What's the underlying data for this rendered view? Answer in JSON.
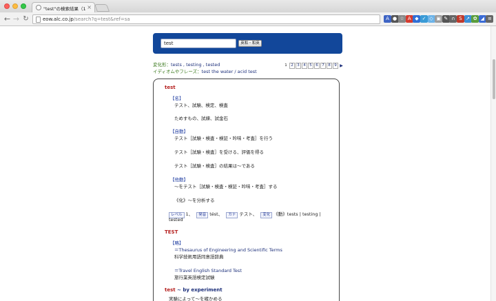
{
  "browser": {
    "tab_title": "\"test\"の検索結果（10184",
    "tab_close": "×",
    "url_host": "eow.alc.co.jp",
    "url_path": "/search?q=test&ref=sa",
    "nav_back": "←",
    "nav_forward": "→",
    "nav_reload": "↻",
    "extensions": [
      {
        "icon": "translate-icon",
        "glyph": "A",
        "color": "#3e64c4"
      },
      {
        "icon": "circle-extension-icon",
        "glyph": "●",
        "color": "#555555"
      },
      {
        "icon": "star-bookmark-icon",
        "glyph": "☆",
        "color": "#888888"
      },
      {
        "icon": "adobe-icon",
        "glyph": "A",
        "color": "#d63b2f"
      },
      {
        "icon": "shield-icon",
        "glyph": "◆",
        "color": "#2f6fd6"
      },
      {
        "icon": "bird-icon",
        "glyph": "✓",
        "color": "#3a9bd6"
      },
      {
        "icon": "cloud-icon",
        "glyph": "◇",
        "color": "#6cb3e8"
      },
      {
        "icon": "bookmark-box-icon",
        "glyph": "▣",
        "color": "#9c9c9c"
      },
      {
        "icon": "tool-icon",
        "glyph": "✎",
        "color": "#555555"
      },
      {
        "icon": "headphone-icon",
        "glyph": "∩",
        "color": "#666666"
      },
      {
        "icon": "s-badge-icon",
        "glyph": "S",
        "color": "#c0392b"
      },
      {
        "icon": "arrow-extension-icon",
        "glyph": "↗",
        "color": "#3c8fd6"
      },
      {
        "icon": "leaf-icon",
        "glyph": "✿",
        "color": "#5a9d3b"
      },
      {
        "icon": "bird-blue-icon",
        "glyph": "◢",
        "color": "#3a6bd6"
      },
      {
        "icon": "menu-icon",
        "glyph": "≡",
        "color": "#666666"
      }
    ]
  },
  "search": {
    "value": "test",
    "button_label": "英和・和英"
  },
  "variant": {
    "label": "変化形：",
    "words": "tests , testing , tested"
  },
  "idiom": {
    "label": "イディオムやフレーズ：",
    "words": "test the water / acid test"
  },
  "pager": {
    "pages": [
      "1",
      "2",
      "3",
      "4",
      "5",
      "6",
      "7",
      "8",
      "9"
    ],
    "current": "1",
    "next": "▶"
  },
  "results": {
    "entry1_head": "test",
    "pos_noun": "【名】",
    "noun_def1": "テスト、試験、検定、検査",
    "noun_def2": "ためすもの、試練、試金石",
    "pos_vi": "【自動】",
    "vi_def1": "テスト［試験・検査・検証・吟味・考査］を行う",
    "vi_def2": "テスト［試験・検査］を受ける、評価を得る",
    "vi_def3": "テスト［試験・検査］の結果は～である",
    "pos_vt": "【他動】",
    "vt_def1": "～をテスト［試験・検査・検証・吟味・考査］する",
    "vt_def2": "《化》～を分析する",
    "tag_level": "レベル",
    "level_value": "1、",
    "tag_pron": "発音",
    "pron_value": "tést、",
    "tag_kana": "カナ",
    "kana_value": "テスト、",
    "tag_inflect": "変化",
    "inflect_value": "《動》tests | testing |",
    "inflect_cont": "tested",
    "entry2_head": "TEST",
    "pos_abbr": "【略】",
    "abbr_def1": "＝Thesaurus of Engineering and Scientific Terms",
    "abbr_def1_jp": "科学技術用語同意語辞典",
    "abbr_def2": "＝Travel English Standard Test",
    "abbr_def2_jp": "旅行業英語検定試験",
    "entry3_head": "test",
    "entry3_rest": " ~ by experiment",
    "entry3_def": "実験によって～を確かめる"
  }
}
